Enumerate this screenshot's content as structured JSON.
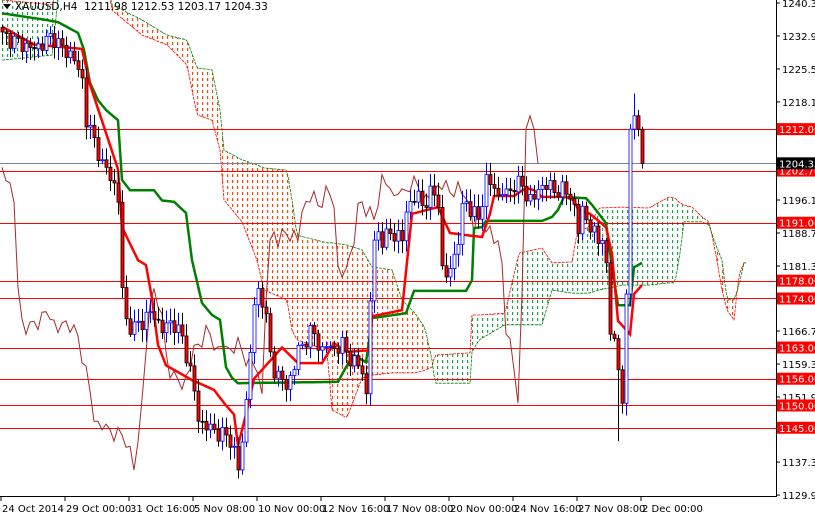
{
  "header": {
    "symbol": "XAUUSD,H4",
    "open": "1211.98",
    "high": "1212.53",
    "low": "1203.17",
    "close": "1204.33"
  },
  "colors": {
    "bull": "#0000ff",
    "bear": "#ff0000",
    "tenkan": "#ff0000",
    "kijun": "#008000",
    "chikou": "#a52a2a",
    "cloud_bear": "#ff4500",
    "cloud_bull": "#22a050",
    "level": "#ff0000",
    "current": "#808080"
  },
  "chart_data": {
    "type": "candlestick",
    "title": "XAUUSD,H4",
    "ylim": [
      1129.9,
      1240.3
    ],
    "yticks": [
      "1240.30",
      "1232.90",
      "1225.50",
      "1218.10",
      "1196.10",
      "1188.70",
      "1181.30",
      "1166.70",
      "1159.30",
      "1151.90",
      "1137.30",
      "1129.90"
    ],
    "xticks": [
      {
        "bar": 0,
        "label": "24 Oct 2014"
      },
      {
        "bar": 16,
        "label": "29 Oct 00:00"
      },
      {
        "bar": 32,
        "label": "31 Oct 16:00"
      },
      {
        "bar": 48,
        "label": "5 Nov 08:00"
      },
      {
        "bar": 64,
        "label": "10 Nov 00:00"
      },
      {
        "bar": 80,
        "label": "12 Nov 16:00"
      },
      {
        "bar": 96,
        "label": "17 Nov 08:00"
      },
      {
        "bar": 112,
        "label": "20 Nov 00:00"
      },
      {
        "bar": 128,
        "label": "24 Nov 16:00"
      },
      {
        "bar": 144,
        "label": "27 Nov 08:00"
      },
      {
        "bar": 160,
        "label": "2 Dec 00:00"
      }
    ],
    "current_price": "1204.33",
    "levels": [
      "1212.00",
      "1202.70",
      "1191.00",
      "1178.00",
      "1174.00",
      "1163.00",
      "1156.00",
      "1150.00",
      "1145.00"
    ],
    "close_keypoints": [
      [
        0,
        1233
      ],
      [
        2.5,
        1232
      ],
      [
        5,
        1231
      ],
      [
        7.5,
        1230
      ],
      [
        10,
        1231
      ],
      [
        12.5,
        1233
      ],
      [
        15,
        1230
      ],
      [
        17.5,
        1228.6
      ],
      [
        20,
        1223
      ],
      [
        21,
        1214
      ],
      [
        24,
        1207
      ],
      [
        25,
        1204
      ],
      [
        27.5,
        1201
      ],
      [
        29,
        1196
      ],
      [
        30,
        1176
      ],
      [
        31,
        1169
      ],
      [
        32.5,
        1167
      ],
      [
        35,
        1169
      ],
      [
        37.5,
        1171
      ],
      [
        40,
        1167
      ],
      [
        42.5,
        1169
      ],
      [
        45,
        1165
      ],
      [
        47.5,
        1156
      ],
      [
        49,
        1147
      ],
      [
        50,
        1146
      ],
      [
        52.5,
        1144.5
      ],
      [
        55,
        1143.5
      ],
      [
        57.5,
        1142
      ],
      [
        59,
        1135.5
      ],
      [
        60,
        1142
      ],
      [
        61,
        1151
      ],
      [
        62.5,
        1169
      ],
      [
        64,
        1176
      ],
      [
        65,
        1174
      ],
      [
        66,
        1169
      ],
      [
        67.5,
        1158
      ],
      [
        70,
        1156
      ],
      [
        71,
        1153.5
      ],
      [
        72.5,
        1158
      ],
      [
        74,
        1162
      ],
      [
        75,
        1163.6
      ],
      [
        76,
        1165
      ],
      [
        77.5,
        1167
      ],
      [
        79,
        1163.6
      ],
      [
        80,
        1162.4
      ],
      [
        81,
        1163.6
      ],
      [
        82.5,
        1162.4
      ],
      [
        85,
        1163.6
      ],
      [
        87.5,
        1160
      ],
      [
        90,
        1158
      ],
      [
        91,
        1152
      ],
      [
        92.5,
        1185
      ],
      [
        94,
        1189
      ],
      [
        95,
        1187
      ],
      [
        97.5,
        1189
      ],
      [
        100,
        1187
      ],
      [
        101,
        1194
      ],
      [
        102.5,
        1196
      ],
      [
        104,
        1197
      ],
      [
        105,
        1195
      ],
      [
        106,
        1196
      ],
      [
        107.5,
        1198
      ],
      [
        109,
        1196
      ],
      [
        110,
        1180
      ],
      [
        111,
        1179
      ],
      [
        112.5,
        1182
      ],
      [
        114,
        1187
      ],
      [
        115,
        1194
      ],
      [
        116,
        1196
      ],
      [
        117.5,
        1193
      ],
      [
        119,
        1192
      ],
      [
        120,
        1196
      ],
      [
        121,
        1200.6
      ],
      [
        122.5,
        1199.5
      ],
      [
        124,
        1197
      ],
      [
        125,
        1198.3
      ],
      [
        126,
        1197
      ],
      [
        127.5,
        1199.5
      ],
      [
        130,
        1199.5
      ],
      [
        131,
        1197
      ],
      [
        132.5,
        1196
      ],
      [
        135,
        1199.5
      ],
      [
        136,
        1199.5
      ],
      [
        137.5,
        1198.3
      ],
      [
        140,
        1198.3
      ],
      [
        142.5,
        1197
      ],
      [
        144,
        1189
      ],
      [
        145,
        1194
      ],
      [
        146,
        1192
      ],
      [
        147.5,
        1189
      ],
      [
        149,
        1187
      ],
      [
        150,
        1187
      ],
      [
        151,
        1182
      ],
      [
        152,
        1166
      ],
      [
        153,
        1165
      ],
      [
        154,
        1158
      ],
      [
        155,
        1150.5
      ],
      [
        156,
        1175
      ],
      [
        157,
        1212
      ],
      [
        158,
        1215
      ],
      [
        159,
        1211.98
      ],
      [
        160,
        1204.33
      ]
    ],
    "tenkan": [
      [
        0,
        1235
      ],
      [
        8,
        1231
      ],
      [
        20,
        1230
      ],
      [
        22,
        1222
      ],
      [
        29,
        1203
      ],
      [
        30,
        1190
      ],
      [
        34,
        1182.6
      ],
      [
        36,
        1181.5
      ],
      [
        37.5,
        1174
      ],
      [
        39,
        1163.6
      ],
      [
        41,
        1159
      ],
      [
        47.5,
        1155.7
      ],
      [
        53,
        1153.5
      ],
      [
        56,
        1150
      ],
      [
        58,
        1148
      ],
      [
        59,
        1141
      ],
      [
        61,
        1148
      ],
      [
        63,
        1156
      ],
      [
        70,
        1163
      ],
      [
        74,
        1159.5
      ],
      [
        80,
        1159.5
      ],
      [
        83,
        1164
      ],
      [
        86,
        1162
      ],
      [
        92,
        1162.4
      ],
      [
        92.5,
        1170
      ],
      [
        100,
        1171.4
      ],
      [
        102.5,
        1193
      ],
      [
        109,
        1194.5
      ],
      [
        112,
        1188.7
      ],
      [
        118,
        1188
      ],
      [
        120,
        1187.8
      ],
      [
        122,
        1193
      ],
      [
        123,
        1197
      ],
      [
        128,
        1197
      ],
      [
        131,
        1198.8
      ],
      [
        133,
        1198.3
      ],
      [
        135,
        1196.8
      ],
      [
        141,
        1196.8
      ],
      [
        143,
        1196
      ],
      [
        144,
        1194
      ],
      [
        147,
        1193
      ],
      [
        151,
        1190
      ],
      [
        152.5,
        1184
      ],
      [
        154,
        1169
      ],
      [
        157,
        1166
      ],
      [
        158,
        1175
      ],
      [
        160,
        1177
      ]
    ],
    "kijun": [
      [
        0,
        1238
      ],
      [
        11,
        1236.5
      ],
      [
        14,
        1236
      ],
      [
        19,
        1233.6
      ],
      [
        20.5,
        1229.8
      ],
      [
        22,
        1222.4
      ],
      [
        24,
        1218.5
      ],
      [
        26,
        1216.3
      ],
      [
        29,
        1214
      ],
      [
        30,
        1200.6
      ],
      [
        32,
        1198.3
      ],
      [
        38,
        1198.3
      ],
      [
        40,
        1196
      ],
      [
        43,
        1195.7
      ],
      [
        46,
        1193.2
      ],
      [
        47.5,
        1182.6
      ],
      [
        50,
        1173
      ],
      [
        52.5,
        1170.3
      ],
      [
        54.5,
        1169.2
      ],
      [
        56,
        1158.6
      ],
      [
        57.5,
        1156.2
      ],
      [
        59,
        1155
      ],
      [
        84,
        1155.3
      ],
      [
        86,
        1158.6
      ],
      [
        88,
        1161.3
      ],
      [
        91,
        1159.7
      ],
      [
        92,
        1166
      ],
      [
        92.5,
        1169.6
      ],
      [
        101,
        1170.7
      ],
      [
        103,
        1175.7
      ],
      [
        116,
        1175.7
      ],
      [
        117.5,
        1178.1
      ],
      [
        118,
        1189.8
      ],
      [
        120,
        1190
      ],
      [
        121,
        1191.4
      ],
      [
        135,
        1191.4
      ],
      [
        137.5,
        1192.3
      ],
      [
        139,
        1193.9
      ],
      [
        140.5,
        1196.8
      ],
      [
        146,
        1196.5
      ],
      [
        147.5,
        1195
      ],
      [
        151,
        1190.9
      ],
      [
        152.5,
        1181.1
      ],
      [
        154,
        1172.5
      ],
      [
        157,
        1172.5
      ],
      [
        158,
        1181
      ],
      [
        160,
        1182
      ]
    ],
    "senkou_a": [
      [
        0,
        1241
      ],
      [
        12.5,
        1239.9
      ],
      [
        14.5,
        1245.5
      ],
      [
        26.25,
        1245.5
      ],
      [
        27.5,
        1238.7
      ],
      [
        35,
        1233.1
      ],
      [
        41.25,
        1230.9
      ],
      [
        46.25,
        1226.4
      ],
      [
        48.75,
        1215.2
      ],
      [
        52.5,
        1214
      ],
      [
        54.5,
        1207.3
      ],
      [
        55.5,
        1196.1
      ],
      [
        60,
        1191.2
      ],
      [
        63.75,
        1182.6
      ],
      [
        65.5,
        1175.9
      ],
      [
        71.25,
        1173.7
      ],
      [
        72.5,
        1166.9
      ],
      [
        73.75,
        1164.7
      ],
      [
        81.25,
        1162.4
      ],
      [
        82.5,
        1149
      ],
      [
        86.25,
        1147.2
      ],
      [
        90,
        1156.2
      ],
      [
        92.5,
        1156.8
      ],
      [
        97.5,
        1157.3
      ],
      [
        100,
        1157.3
      ],
      [
        103.25,
        1157.3
      ],
      [
        105.75,
        1157.9
      ],
      [
        107.5,
        1158.6
      ],
      [
        108.25,
        1161.3
      ],
      [
        117,
        1161.8
      ],
      [
        117.5,
        1170.3
      ],
      [
        119.25,
        1170.3
      ],
      [
        125.75,
        1170.7
      ],
      [
        129.25,
        1184.2
      ],
      [
        135,
        1185.3
      ],
      [
        137.5,
        1182
      ],
      [
        142.5,
        1182.2
      ],
      [
        143.75,
        1188.7
      ],
      [
        146.75,
        1190.1
      ],
      [
        149.25,
        1194.3
      ],
      [
        155,
        1194.5
      ],
      [
        161.75,
        1194.3
      ],
      [
        166.75,
        1196.8
      ],
      [
        168.25,
        1196.5
      ],
      [
        169.5,
        1195.4
      ],
      [
        170.5,
        1195
      ],
      [
        172.5,
        1194.5
      ],
      [
        175,
        1192.3
      ],
      [
        176.75,
        1191.2
      ],
      [
        178.25,
        1185
      ],
      [
        180,
        1175.9
      ],
      [
        181.25,
        1171.4
      ],
      [
        183,
        1169.2
      ],
      [
        184.25,
        1179.3
      ],
      [
        185.5,
        1182
      ],
      [
        186.25,
        1182
      ]
    ],
    "senkou_b": [
      [
        0,
        1227.5
      ],
      [
        12.5,
        1228.6
      ],
      [
        14.5,
        1245.5
      ],
      [
        26.25,
        1245.5
      ],
      [
        27.5,
        1239.9
      ],
      [
        35,
        1236.5
      ],
      [
        41.25,
        1233.1
      ],
      [
        46.25,
        1232
      ],
      [
        48.75,
        1225.7
      ],
      [
        52.5,
        1225.3
      ],
      [
        54.5,
        1216.3
      ],
      [
        55.5,
        1207.3
      ],
      [
        60,
        1205.1
      ],
      [
        63.75,
        1204
      ],
      [
        65.5,
        1203.3
      ],
      [
        71.25,
        1202.8
      ],
      [
        72.5,
        1196.1
      ],
      [
        73.75,
        1188.2
      ],
      [
        81.25,
        1186.5
      ],
      [
        82.5,
        1186.5
      ],
      [
        86.25,
        1186
      ],
      [
        90,
        1184.9
      ],
      [
        92.5,
        1181.1
      ],
      [
        97.5,
        1180.4
      ],
      [
        100,
        1173.7
      ],
      [
        103.25,
        1170.7
      ],
      [
        105.75,
        1167.4
      ],
      [
        107.5,
        1160.2
      ],
      [
        108.25,
        1155
      ],
      [
        117,
        1155
      ],
      [
        117.5,
        1162
      ],
      [
        119.25,
        1164.7
      ],
      [
        125.75,
        1168.1
      ],
      [
        129.25,
        1168.1
      ],
      [
        135,
        1168.1
      ],
      [
        137.5,
        1175.9
      ],
      [
        142.5,
        1175.2
      ],
      [
        143.75,
        1175.2
      ],
      [
        146.75,
        1175.2
      ],
      [
        149.25,
        1175.9
      ],
      [
        155,
        1177
      ],
      [
        161.75,
        1177
      ],
      [
        166.75,
        1177.5
      ],
      [
        168.25,
        1177.5
      ],
      [
        169.5,
        1184.2
      ],
      [
        170.5,
        1191.2
      ],
      [
        172.5,
        1191.2
      ],
      [
        175,
        1191.2
      ],
      [
        176.75,
        1190.5
      ],
      [
        178.25,
        1186.5
      ],
      [
        180,
        1182.6
      ],
      [
        181.25,
        1173.7
      ],
      [
        183,
        1173.7
      ],
      [
        184.25,
        1177
      ],
      [
        185.5,
        1182
      ],
      [
        186.25,
        1182
      ]
    ]
  }
}
